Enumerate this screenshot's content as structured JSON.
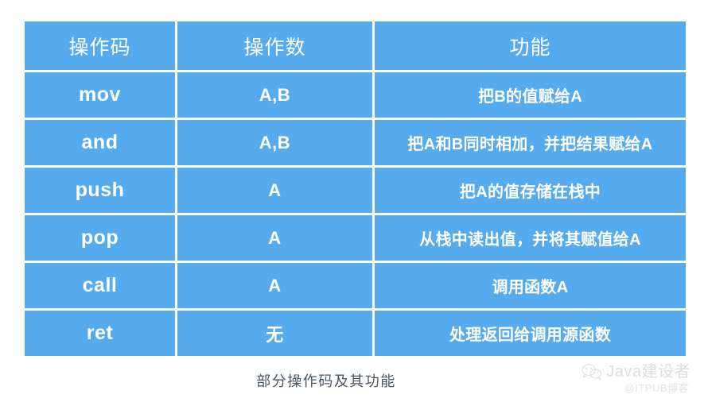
{
  "background_color": "#ffffff",
  "table": {
    "accent_color": "#55abee",
    "text_color": "#ffffff",
    "grid_color": "#ffffff",
    "headers": {
      "opcode": "操作码",
      "operand": "操作数",
      "function": "功能"
    },
    "rows": [
      {
        "opcode": "mov",
        "operand": "A,B",
        "function": "把B的值赋给A"
      },
      {
        "opcode": "and",
        "operand": "A,B",
        "function": "把A和B同时相加，并把结果赋给A"
      },
      {
        "opcode": "push",
        "operand": "A",
        "function": "把A的值存储在栈中"
      },
      {
        "opcode": "pop",
        "operand": "A",
        "function": "从栈中读出值，并将其赋值给A"
      },
      {
        "opcode": "call",
        "operand": "A",
        "function": "调用函数A"
      },
      {
        "opcode": "ret",
        "operand": "无",
        "function": "处理返回给调用源函数"
      }
    ]
  },
  "caption": {
    "text": "部分操作码及其功能",
    "color": "#4a5560"
  },
  "watermark": {
    "icon": "wechat-icon",
    "title": "Java建设者",
    "subtitle": "@ITPUB博客",
    "color": "#8a9099"
  }
}
